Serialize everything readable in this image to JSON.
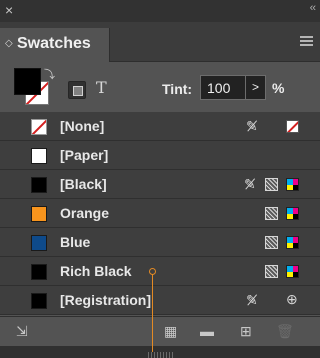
{
  "window": {
    "close_glyph": "×",
    "collapse_glyph": "‹‹"
  },
  "panel": {
    "tab_label": "Swatches",
    "tab_icon": "chevron-updown-icon",
    "menu_icon": "panel-menu-icon"
  },
  "toolbar": {
    "fill_color": "#000000",
    "stroke": "none",
    "formatting_text_glyph": "T",
    "tint_label": "Tint:",
    "tint_value": "100",
    "tint_stepper_glyph": ">",
    "tint_unit": "%"
  },
  "swatches": [
    {
      "name": "[None]",
      "color": "none",
      "locked": true,
      "mode": "none"
    },
    {
      "name": "[Paper]",
      "color": "#ffffff",
      "locked": false,
      "mode": ""
    },
    {
      "name": "[Black]",
      "color": "#000000",
      "locked": true,
      "mode": "process-cmyk"
    },
    {
      "name": "Orange",
      "color": "#f7941d",
      "locked": false,
      "mode": "process-cmyk"
    },
    {
      "name": "Blue",
      "color": "#0e4a8a",
      "locked": false,
      "mode": "process-cmyk"
    },
    {
      "name": "Rich Black",
      "color": "#000000",
      "locked": false,
      "mode": "process-cmyk"
    },
    {
      "name": "[Registration]",
      "color": "#000000",
      "locked": true,
      "mode": "registration"
    }
  ],
  "bottom_bar": [
    "show-swatch-kinds-icon",
    "swatch-views-icon",
    "new-color-group-icon",
    "new-swatch-icon",
    "delete-swatch-icon"
  ],
  "colors": {
    "panel_bg": "#535353",
    "row_bg": "#3e3e3e",
    "accent_cursor": "#e38a24",
    "none_red": "#d42020"
  }
}
